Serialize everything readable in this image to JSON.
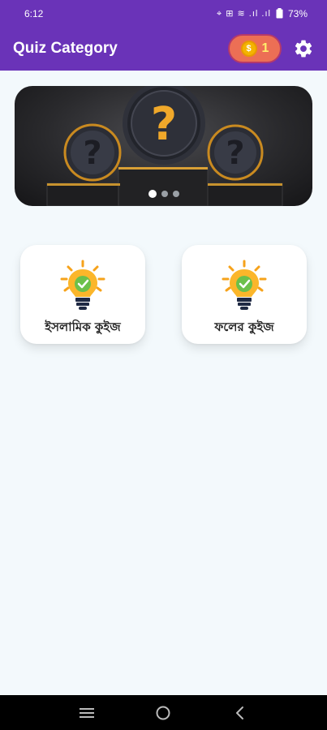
{
  "status": {
    "time": "6:12",
    "signal": "⌖ ⊞ ≋ .ıl .ıl",
    "battery": "73%"
  },
  "app_bar": {
    "title": "Quiz Category",
    "coin_symbol": "$",
    "coin_count": "1"
  },
  "banner": {
    "slides": 3,
    "active_slide": 0
  },
  "categories": [
    {
      "label": "ইসলামিক কুইজ"
    },
    {
      "label": "ফলের কুইজ"
    }
  ],
  "colors": {
    "primary": "#6a33b8",
    "coin_pill": "#ec6f55",
    "background": "#f3f9fc"
  },
  "icons": {
    "settings": "gear-icon",
    "coin": "coin-icon",
    "category": "lightbulb-check-icon",
    "nav": [
      "recents-icon",
      "home-icon",
      "back-icon"
    ]
  }
}
